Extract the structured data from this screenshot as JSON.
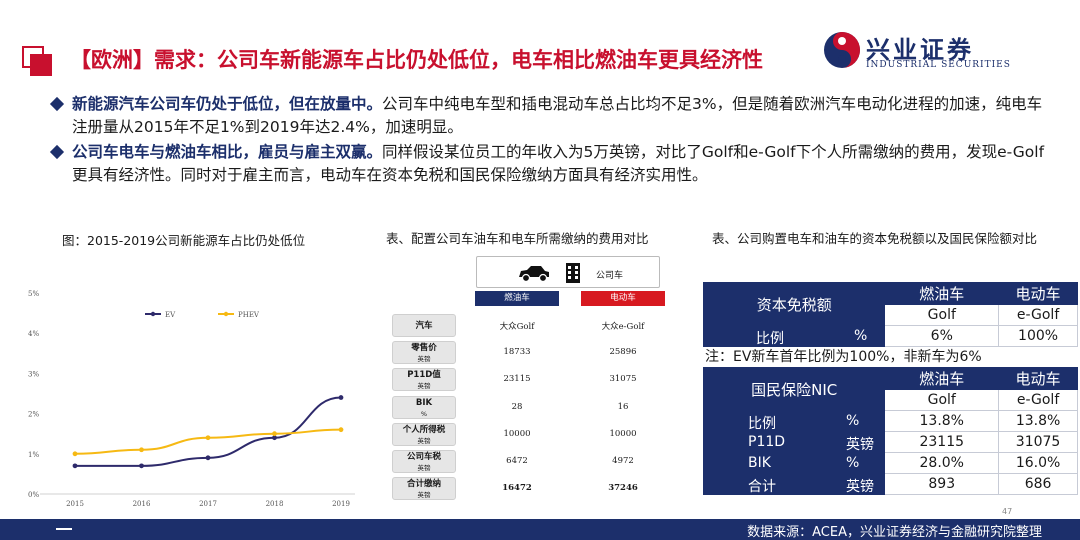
{
  "header": {
    "title": "【欧洲】需求：公司车新能源车占比仍处低位，电车相比燃油车更具经济性",
    "brand_name": "兴业证券",
    "brand_en": "INDUSTRIAL SECURITIES"
  },
  "bullets": [
    {
      "bold": "新能源汽车公司车仍处于低位，但在放量中。",
      "text": "公司车中纯电车型和插电混动车总占比均不足3%，但是随着欧洲汽车电动化进程的加速，纯电车注册量从2015年不足1%到2019年达2.4%，加速明显。"
    },
    {
      "bold": "公司车电车与燃油车相比，雇员与雇主双赢。",
      "text": "同样假设某位员工的年收入为5万英镑，对比了Golf和e-Golf下个人所需缴纳的费用，发现e-Golf更具有经济性。同时对于雇主而言，电动车在资本免税和国民保险缴纳方面具有经济实用性。"
    }
  ],
  "chart": {
    "title": "图：2015-2019公司新能源车占比仍处低位"
  },
  "chart_data": {
    "type": "line",
    "title": "图：2015-2019公司新能源车占比仍处低位",
    "x": [
      "2015",
      "2016",
      "2017",
      "2018",
      "2019"
    ],
    "y_ticks": [
      "0%",
      "1%",
      "2%",
      "3%",
      "4%",
      "5%"
    ],
    "ylim": [
      0,
      5
    ],
    "grid": false,
    "legend": "top-left",
    "series": [
      {
        "name": "EV",
        "values": [
          0.7,
          0.7,
          0.9,
          1.4,
          2.4
        ],
        "color": "#2e2a6b"
      },
      {
        "name": "PHEV",
        "values": [
          1.0,
          1.1,
          1.4,
          1.5,
          1.6
        ],
        "color": "#f6b913"
      }
    ]
  },
  "mid_table": {
    "caption": "表、配置公司车油车和电车所需缴纳的费用对比",
    "header_label": "公司车",
    "col_ice": "燃油车",
    "col_ev": "电动车",
    "rows": [
      {
        "label": "汽车",
        "unit": "",
        "ice": "大众Golf",
        "ev": "大众e-Golf",
        "bold": false
      },
      {
        "label": "零售价",
        "unit": "英镑",
        "ice": "18733",
        "ev": "25896",
        "bold": false
      },
      {
        "label": "P11D值",
        "unit": "英镑",
        "ice": "23115",
        "ev": "31075",
        "bold": false
      },
      {
        "label": "BIK",
        "unit": "%",
        "ice": "28",
        "ev": "16",
        "bold": false
      },
      {
        "label": "个人所得税",
        "unit": "英镑",
        "ice": "10000",
        "ev": "10000",
        "bold": false
      },
      {
        "label": "公司车税",
        "unit": "英镑",
        "ice": "6472",
        "ev": "4972",
        "bold": false
      },
      {
        "label": "合计缴纳",
        "unit": "英镑",
        "ice": "16472",
        "ev": "37246",
        "bold": true
      }
    ]
  },
  "right_table": {
    "caption": "表、公司购置电车和油车的资本免税额以及国民保险额对比",
    "t1": {
      "title": "资本免税额",
      "col_ice": "燃油车",
      "col_ev": "电动车",
      "model_ice": "Golf",
      "model_ev": "e-Golf",
      "row_label": "比例",
      "row_unit": "%",
      "row_ice": "6%",
      "row_ev": "100%"
    },
    "note": "注：EV新车首年比例为100%，非新车为6%",
    "t2": {
      "title": "国民保险NIC",
      "col_ice": "燃油车",
      "col_ev": "电动车",
      "model_ice": "Golf",
      "model_ev": "e-Golf",
      "rows": [
        {
          "label": "比例",
          "unit": "%",
          "ice": "13.8%",
          "ev": "13.8%"
        },
        {
          "label": "P11D",
          "unit": "英镑",
          "ice": "23115",
          "ev": "31075"
        },
        {
          "label": "BIK",
          "unit": "%",
          "ice": "28.0%",
          "ev": "16.0%"
        },
        {
          "label": "合计",
          "unit": "英镑",
          "ice": "893",
          "ev": "686"
        }
      ]
    }
  },
  "footer": {
    "page_number": "47",
    "source": "数据来源：ACEA，兴业证券经济与金融研究院整理"
  }
}
